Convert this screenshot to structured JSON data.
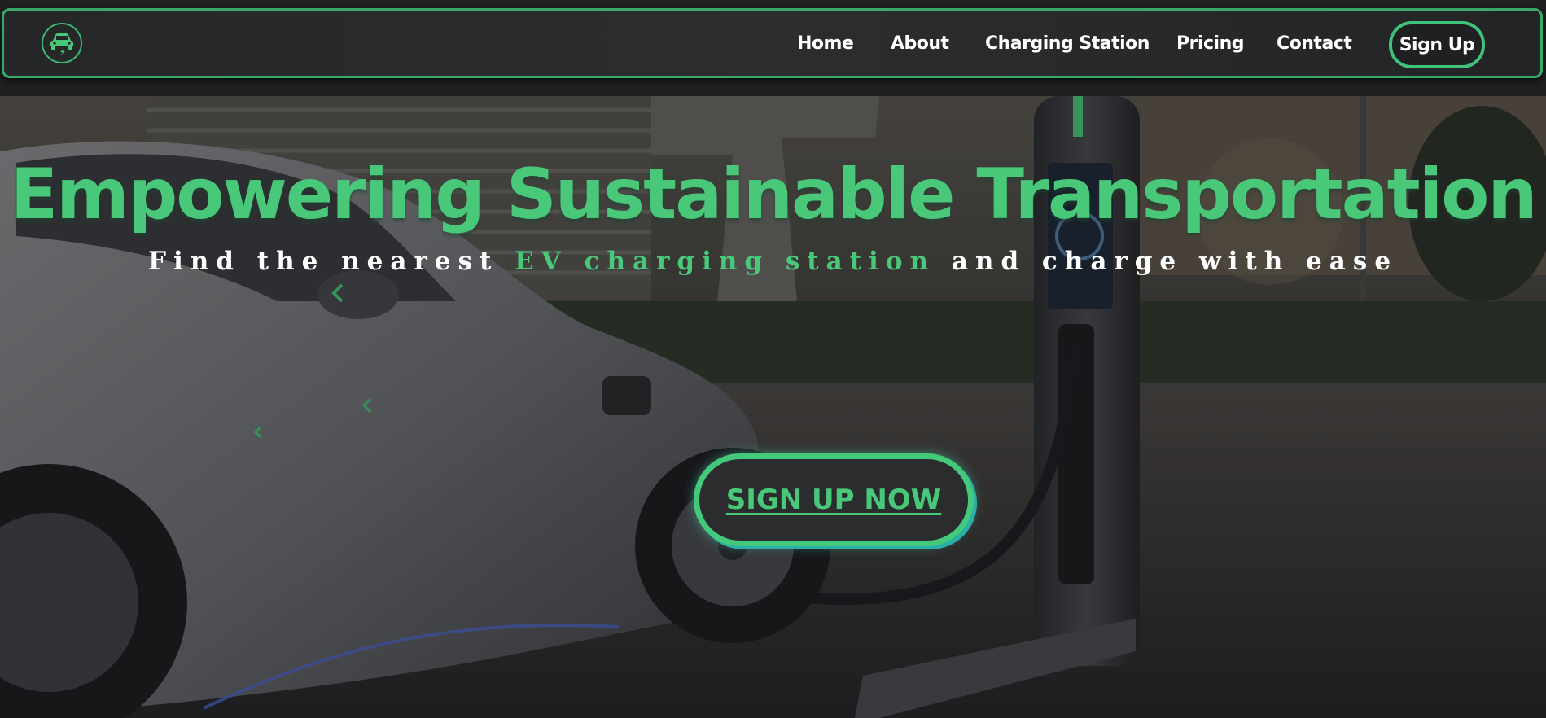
{
  "nav": {
    "logo_icon": "ev-car-charging-icon",
    "items": [
      {
        "label": "Home"
      },
      {
        "label": "About"
      },
      {
        "label": "Charging Station"
      },
      {
        "label": "Pricing"
      },
      {
        "label": "Contact"
      }
    ],
    "signup_label": "Sign Up"
  },
  "hero": {
    "title": "Empowering Sustainable Transportation",
    "subtitle_before": "Find the nearest ",
    "subtitle_accent": "EV charging station",
    "subtitle_after": " and charge with ease",
    "cta_label": "SIGN UP NOW",
    "background_image": "electric-car-at-charging-station-photo"
  },
  "colors": {
    "accent": "#48c878",
    "nav_border": "#3aa86a",
    "cta_glow": "#2ab0a8",
    "text": "#ffffff",
    "background": "#222426"
  }
}
